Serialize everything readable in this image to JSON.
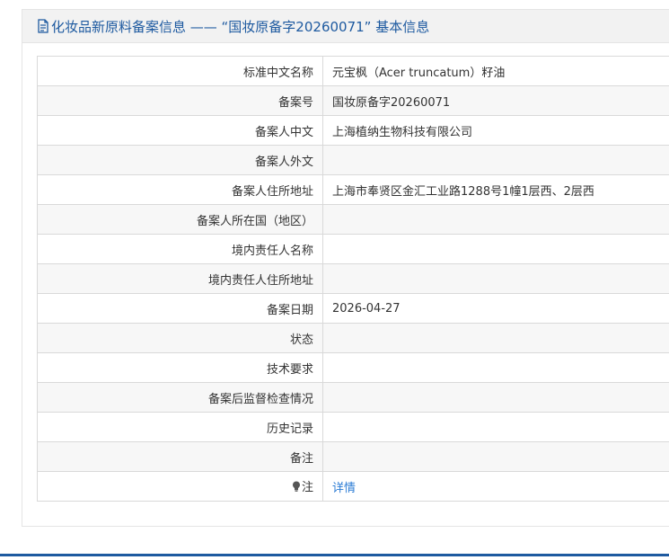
{
  "header": {
    "title": "化妆品新原料备案信息 —— “国妆原备字20260071” 基本信息",
    "icon": "document-icon",
    "color": "#1e5aa0"
  },
  "rows": [
    {
      "label": "标准中文名称",
      "value": "元宝枫（Acer truncatum）籽油"
    },
    {
      "label": "备案号",
      "value": "国妆原备字20260071"
    },
    {
      "label": "备案人中文",
      "value": "上海植纳生物科技有限公司"
    },
    {
      "label": "备案人外文",
      "value": ""
    },
    {
      "label": "备案人住所地址",
      "value": "上海市奉贤区金汇工业路1288号1幢1层西、2层西"
    },
    {
      "label": "备案人所在国（地区）",
      "value": ""
    },
    {
      "label": "境内责任人名称",
      "value": ""
    },
    {
      "label": "境内责任人住所地址",
      "value": ""
    },
    {
      "label": "备案日期",
      "value": "2026-04-27"
    },
    {
      "label": "状态",
      "value": ""
    },
    {
      "label": "技术要求",
      "value": ""
    },
    {
      "label": "备案后监督检查情况",
      "value": ""
    },
    {
      "label": "历史记录",
      "value": ""
    },
    {
      "label": "备注",
      "value": ""
    }
  ],
  "note_row": {
    "label": "注",
    "icon": "lightbulb-icon",
    "link_text": "详情",
    "link_color": "#2a7bd4"
  }
}
